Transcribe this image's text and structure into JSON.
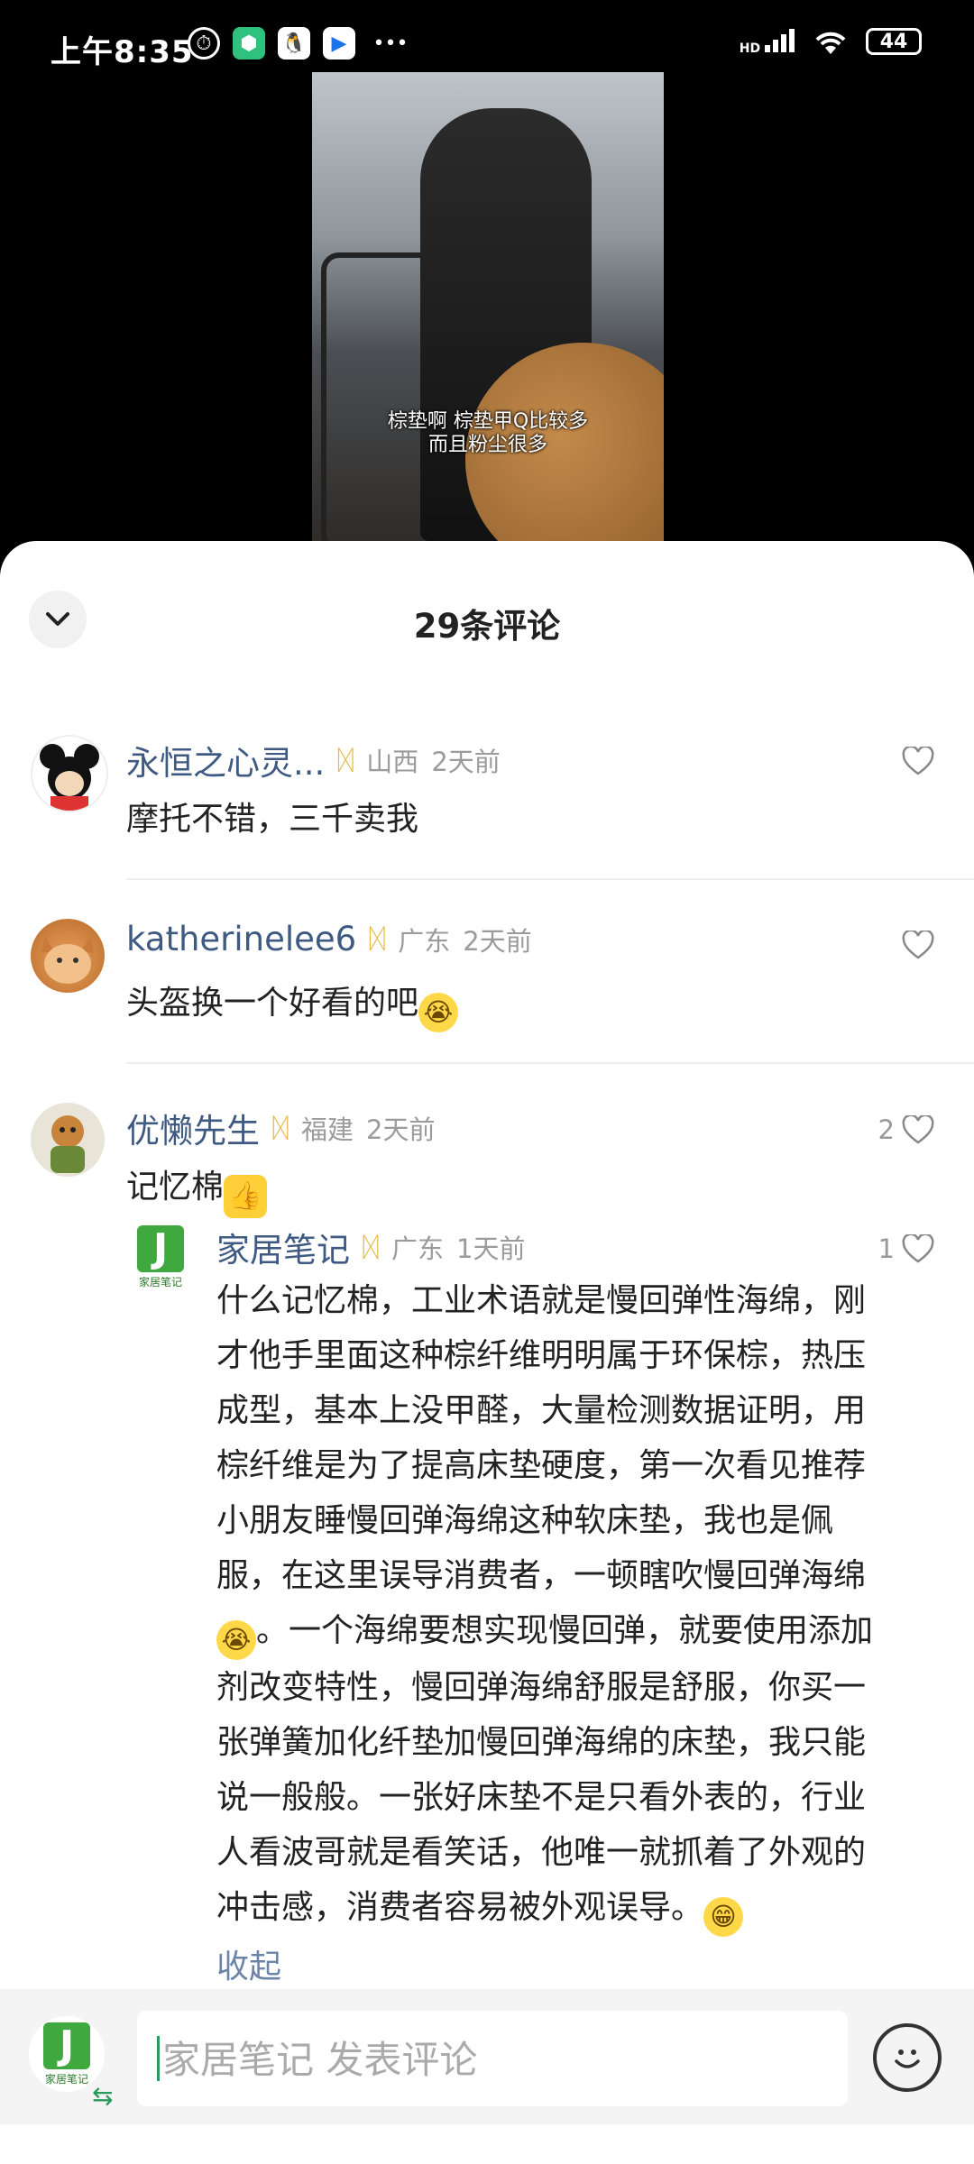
{
  "status_bar": {
    "time": "上午8:35",
    "battery": "44",
    "network": "HD"
  },
  "video": {
    "caption_line1": "棕垫啊 棕垫甲Q比较多",
    "caption_line2": "而且粉尘很多"
  },
  "sheet": {
    "title": "29条评论"
  },
  "comments": [
    {
      "name": "永恒之心灵...",
      "location": "山西",
      "time": "2天前",
      "text": "摩托不错，三千卖我",
      "likes": ""
    },
    {
      "name": "katherinelee6",
      "location": "广东",
      "time": "2天前",
      "text": "头盔换一个好看的吧",
      "likes": ""
    },
    {
      "name": "优懒先生",
      "location": "福建",
      "time": "2天前",
      "text": "记忆棉",
      "likes": "2"
    }
  ],
  "reply": {
    "name": "家居笔记",
    "location": "广东",
    "time": "1天前",
    "likes": "1",
    "lines": [
      "什么记忆棉，工业术语就是慢回弹性海绵，刚",
      "才他手里面这种棕纤维明明属于环保棕，热压",
      "成型，基本上没甲醛，大量检测数据证明，用",
      "棕纤维是为了提高床垫硬度，第一次看见推荐",
      "小朋友睡慢回弹海绵这种软床垫，我也是佩",
      "服，在这里误导消费者，一顿瞎吹慢回弹海绵",
      "。一个海绵要想实现慢回弹，就要使用添加",
      "剂改变特性，慢回弹海绵舒服是舒服，你买一",
      "张弹簧加化纤垫加慢回弹海绵的床垫，我只能",
      "说一般般。一张好床垫不是只看外表的，行业",
      "人看波哥就是看笑话，他唯一就抓着了外观的",
      "冲击感，消费者容易被外观误导。"
    ],
    "collapse_label": "收起",
    "logo_text": "家居笔记"
  },
  "composer": {
    "placeholder": "家居笔记 发表评论"
  }
}
